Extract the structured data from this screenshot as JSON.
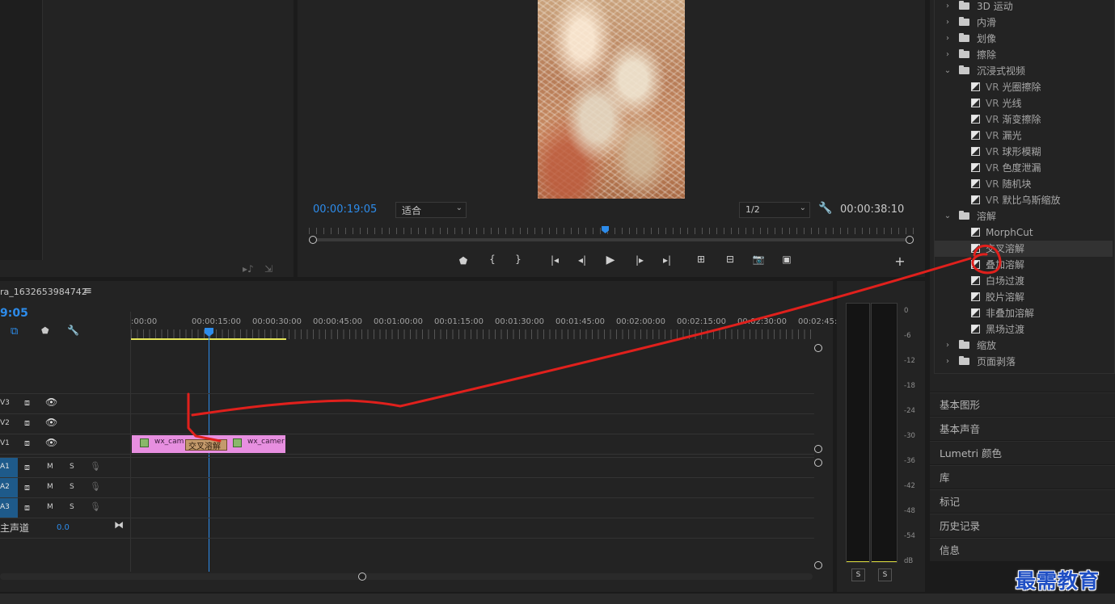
{
  "effects_tree": [
    {
      "type": "folder",
      "label": "3D 运动",
      "open": false,
      "indent": 0
    },
    {
      "type": "folder",
      "label": "内滑",
      "open": false,
      "indent": 0
    },
    {
      "type": "folder",
      "label": "划像",
      "open": false,
      "indent": 0
    },
    {
      "type": "folder",
      "label": "擦除",
      "open": false,
      "indent": 0
    },
    {
      "type": "folder",
      "label": "沉浸式视频",
      "open": true,
      "indent": 0
    },
    {
      "type": "fx",
      "vr": "VR",
      "label": "光圈擦除",
      "indent": 1
    },
    {
      "type": "fx",
      "vr": "VR",
      "label": "光线",
      "indent": 1
    },
    {
      "type": "fx",
      "vr": "VR",
      "label": "渐变擦除",
      "indent": 1
    },
    {
      "type": "fx",
      "vr": "VR",
      "label": "漏光",
      "indent": 1
    },
    {
      "type": "fx",
      "vr": "VR",
      "label": "球形模糊",
      "indent": 1
    },
    {
      "type": "fx",
      "vr": "VR",
      "label": "色度泄漏",
      "indent": 1
    },
    {
      "type": "fx",
      "vr": "VR",
      "label": "随机块",
      "indent": 1
    },
    {
      "type": "fx",
      "vr": "VR",
      "label": "默比乌斯缩放",
      "indent": 1
    },
    {
      "type": "folder",
      "label": "溶解",
      "open": true,
      "indent": 0
    },
    {
      "type": "fx",
      "vr": "",
      "label": "MorphCut",
      "indent": 1
    },
    {
      "type": "fx",
      "vr": "",
      "label": "交叉溶解",
      "indent": 1,
      "selected": true
    },
    {
      "type": "fx",
      "vr": "",
      "label": "叠加溶解",
      "indent": 1
    },
    {
      "type": "fx",
      "vr": "",
      "label": "白场过渡",
      "indent": 1
    },
    {
      "type": "fx",
      "vr": "",
      "label": "胶片溶解",
      "indent": 1
    },
    {
      "type": "fx",
      "vr": "",
      "label": "非叠加溶解",
      "indent": 1
    },
    {
      "type": "fx",
      "vr": "",
      "label": "黑场过渡",
      "indent": 1
    },
    {
      "type": "folder",
      "label": "缩放",
      "open": false,
      "indent": 0
    },
    {
      "type": "folder",
      "label": "页面剥落",
      "open": false,
      "indent": 0
    }
  ],
  "side_panels": [
    "基本图形",
    "基本声音",
    "Lumetri 颜色",
    "库",
    "标记",
    "历史记录",
    "信息"
  ],
  "program_monitor": {
    "timecode_current": "00:00:19:05",
    "fit_value": "适合",
    "resolution_value": "1/2",
    "timecode_duration": "00:00:38:10",
    "playhead_fraction": 0.49
  },
  "transport_icons": [
    "marker-icon",
    "mark-in-icon",
    "mark-out-icon",
    "go-to-in-icon",
    "step-back-icon",
    "play-icon",
    "step-forward-icon",
    "go-to-out-icon",
    "lift-icon",
    "extract-icon",
    "export-frame-icon",
    "compare-icon",
    "add-button-icon"
  ],
  "timeline": {
    "sequence_name": "ra_1632653984742",
    "menu_glyph": "≡",
    "timecode": "9:05",
    "ruler_labels": [
      ":00:00",
      "00:00:15:00",
      "00:00:30:00",
      "00:00:45:00",
      "00:01:00:00",
      "00:01:15:00",
      "00:01:30:00",
      "00:01:45:00",
      "00:02:00:00",
      "00:02:15:00",
      "00:02:30:00",
      "00:02:45:"
    ],
    "video_tracks": [
      "V3",
      "V2",
      "V1"
    ],
    "audio_tracks": [
      "A1",
      "A2",
      "A3"
    ],
    "track_m": "M",
    "track_s": "S",
    "master_label": "主声道",
    "master_value": "0.0",
    "clips": [
      {
        "label": "wx_cam",
        "name": "clip-a"
      },
      {
        "label": "wx_camer",
        "name": "clip-b"
      }
    ],
    "transition_label": "交叉溶解"
  },
  "audio_meter": {
    "scale": [
      "0",
      "-6",
      "-12",
      "-18",
      "-24",
      "-30",
      "-36",
      "-42",
      "-48",
      "-54",
      "dB"
    ],
    "solo_labels": [
      "S",
      "S"
    ]
  },
  "watermark": "最需教育",
  "colors": {
    "accent_blue": "#2d8ceb",
    "clip_pink": "#e78fe0",
    "transition_tan": "#c49a6c",
    "annotation_red": "#e0201c",
    "track_blue": "#1e5a8a"
  }
}
